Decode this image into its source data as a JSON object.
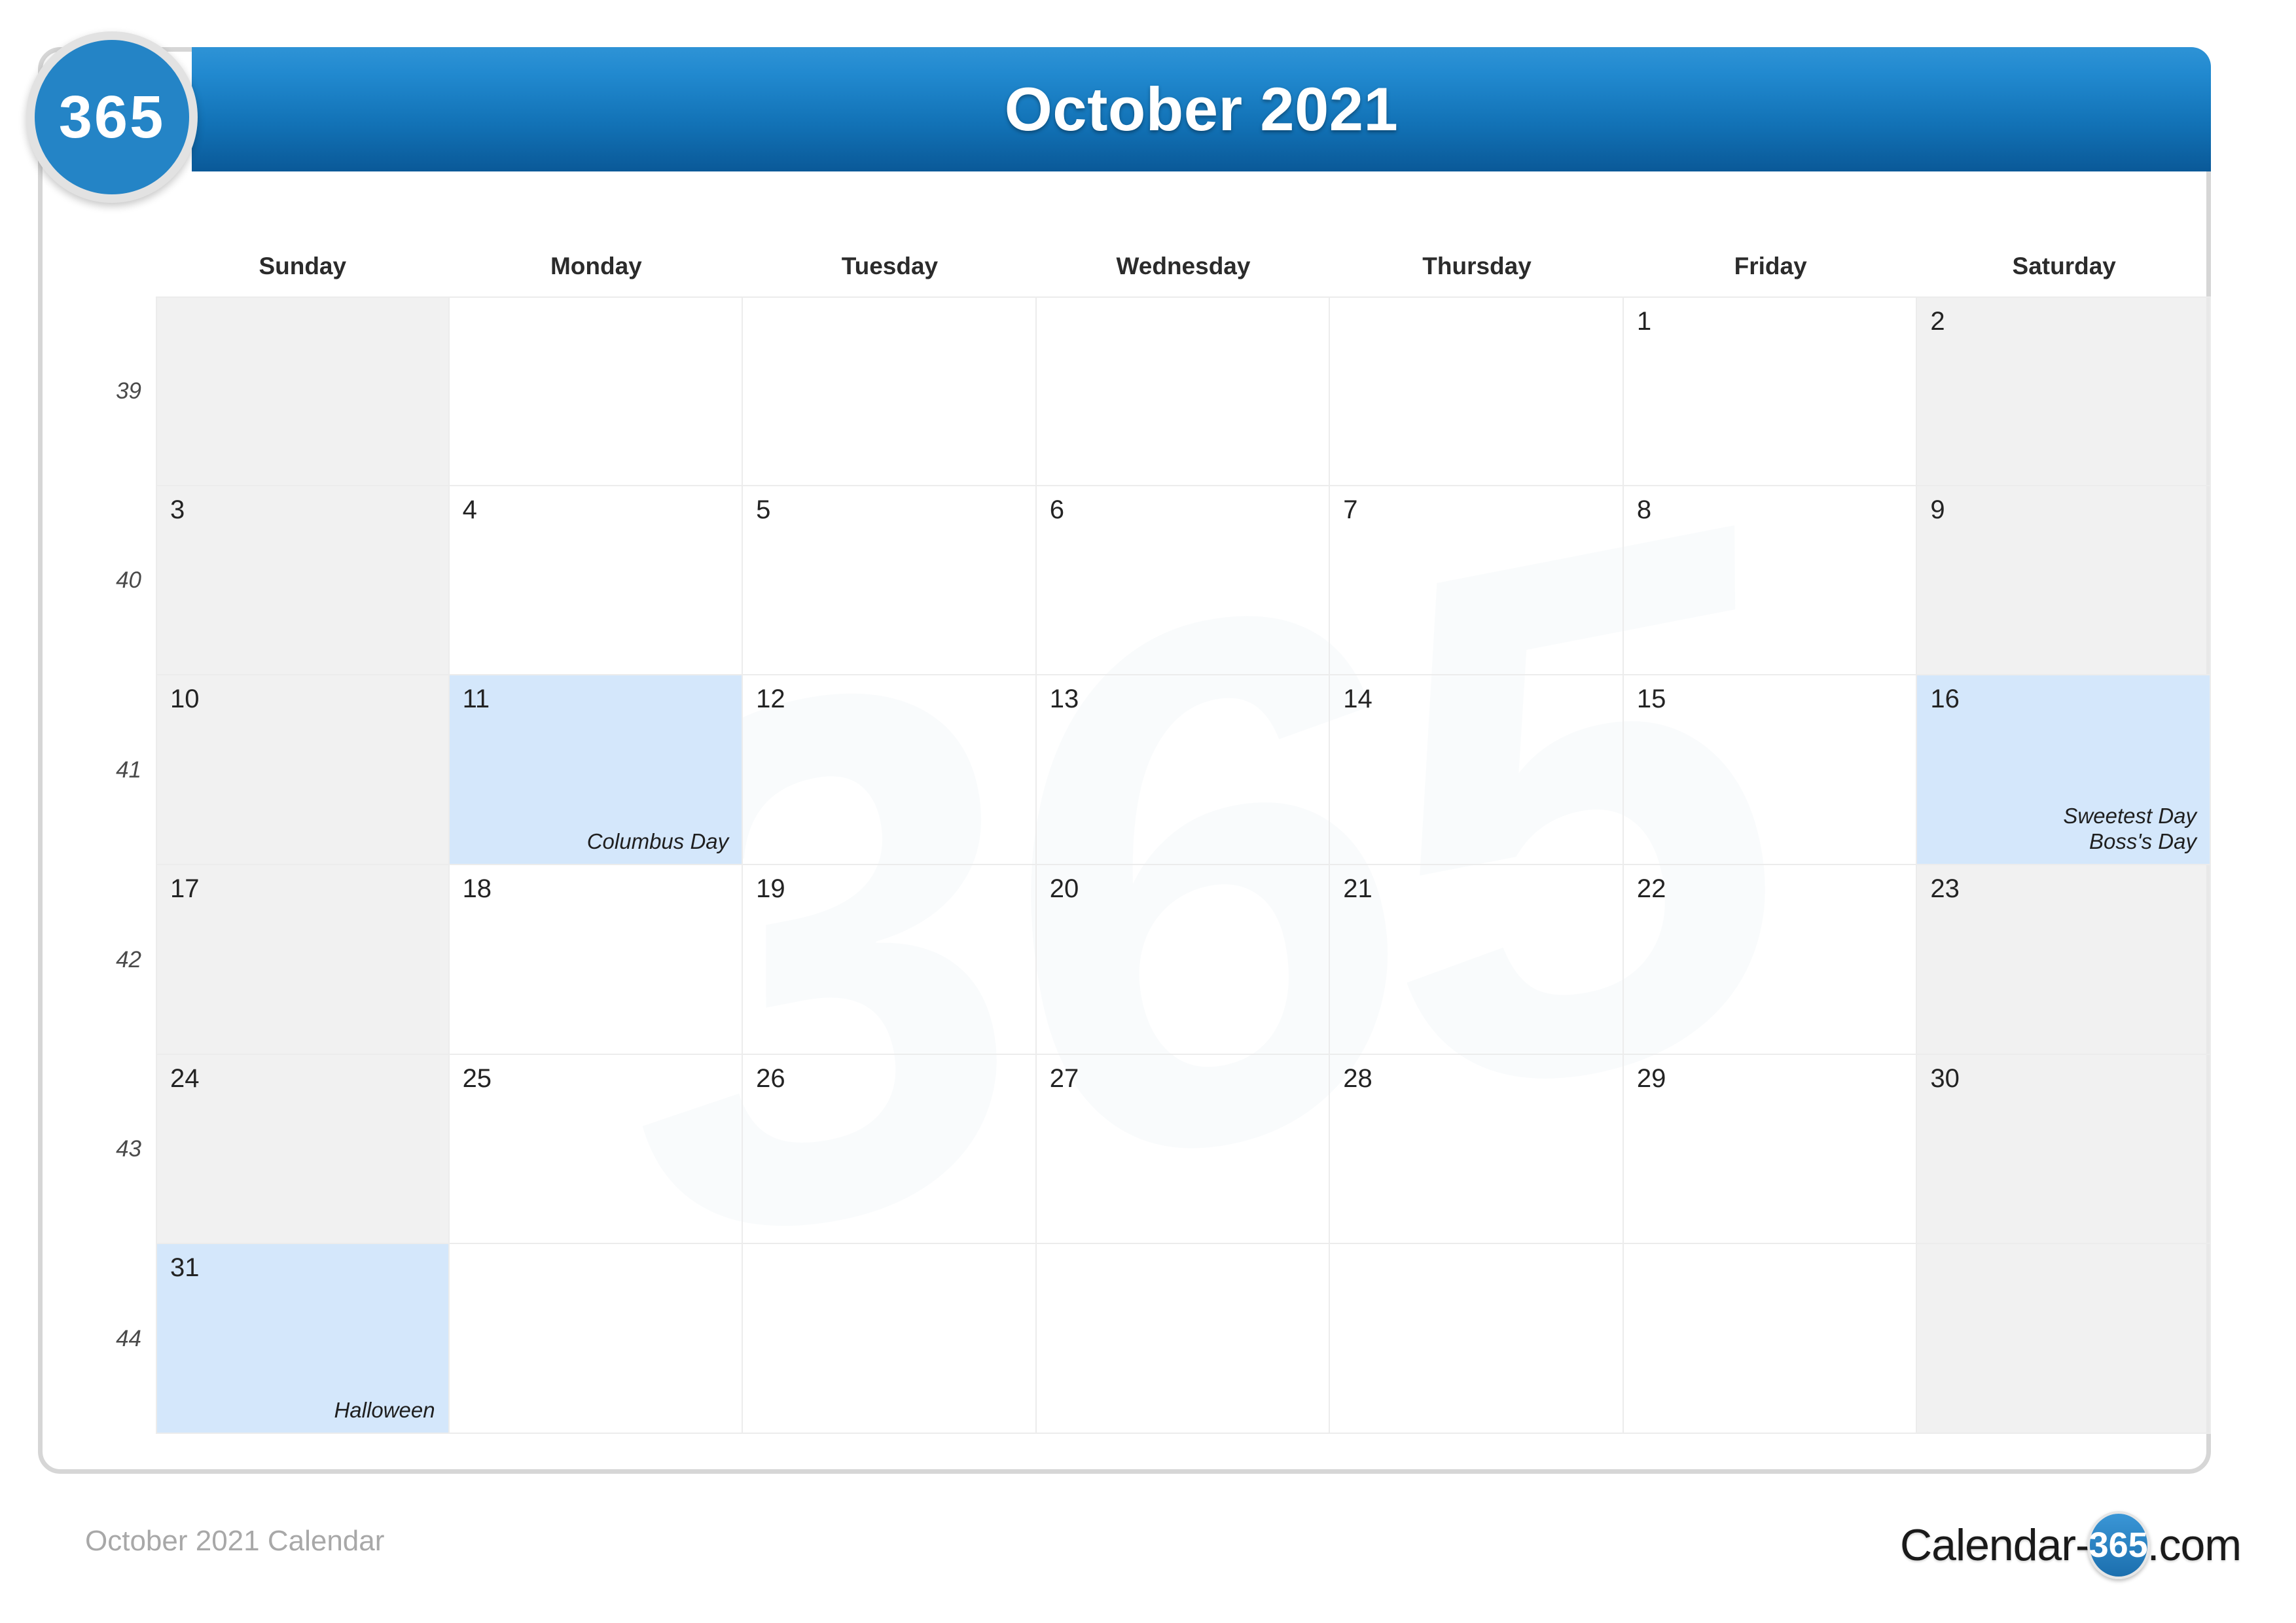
{
  "brand": {
    "badge_text": "365"
  },
  "header": {
    "title": "October 2021"
  },
  "weekdays": [
    "Sunday",
    "Monday",
    "Tuesday",
    "Wednesday",
    "Thursday",
    "Friday",
    "Saturday"
  ],
  "week_numbers": [
    "39",
    "40",
    "41",
    "42",
    "43",
    "44"
  ],
  "colors": {
    "header_blue_top": "#2e93d6",
    "header_blue_bottom": "#0a5998",
    "badge_blue": "#2484c6",
    "weekend_gray": "#ededed",
    "holiday_blue": "#d4e7fb",
    "grid_line": "#ececec",
    "card_border": "#d6d6d6",
    "footer_gray": "#a8a8a8"
  },
  "weeks": [
    {
      "week": "39",
      "days": [
        {
          "num": "",
          "weekend": true,
          "holiday": false,
          "events": []
        },
        {
          "num": "",
          "weekend": false,
          "holiday": false,
          "events": []
        },
        {
          "num": "",
          "weekend": false,
          "holiday": false,
          "events": []
        },
        {
          "num": "",
          "weekend": false,
          "holiday": false,
          "events": []
        },
        {
          "num": "",
          "weekend": false,
          "holiday": false,
          "events": []
        },
        {
          "num": "1",
          "weekend": false,
          "holiday": false,
          "events": []
        },
        {
          "num": "2",
          "weekend": true,
          "holiday": false,
          "events": []
        }
      ]
    },
    {
      "week": "40",
      "days": [
        {
          "num": "3",
          "weekend": true,
          "holiday": false,
          "events": []
        },
        {
          "num": "4",
          "weekend": false,
          "holiday": false,
          "events": []
        },
        {
          "num": "5",
          "weekend": false,
          "holiday": false,
          "events": []
        },
        {
          "num": "6",
          "weekend": false,
          "holiday": false,
          "events": []
        },
        {
          "num": "7",
          "weekend": false,
          "holiday": false,
          "events": []
        },
        {
          "num": "8",
          "weekend": false,
          "holiday": false,
          "events": []
        },
        {
          "num": "9",
          "weekend": true,
          "holiday": false,
          "events": []
        }
      ]
    },
    {
      "week": "41",
      "days": [
        {
          "num": "10",
          "weekend": true,
          "holiday": false,
          "events": []
        },
        {
          "num": "11",
          "weekend": false,
          "holiday": true,
          "events": [
            "Columbus Day"
          ]
        },
        {
          "num": "12",
          "weekend": false,
          "holiday": false,
          "events": []
        },
        {
          "num": "13",
          "weekend": false,
          "holiday": false,
          "events": []
        },
        {
          "num": "14",
          "weekend": false,
          "holiday": false,
          "events": []
        },
        {
          "num": "15",
          "weekend": false,
          "holiday": false,
          "events": []
        },
        {
          "num": "16",
          "weekend": true,
          "holiday": true,
          "events": [
            "Sweetest Day",
            "Boss's Day"
          ]
        }
      ]
    },
    {
      "week": "42",
      "days": [
        {
          "num": "17",
          "weekend": true,
          "holiday": false,
          "events": []
        },
        {
          "num": "18",
          "weekend": false,
          "holiday": false,
          "events": []
        },
        {
          "num": "19",
          "weekend": false,
          "holiday": false,
          "events": []
        },
        {
          "num": "20",
          "weekend": false,
          "holiday": false,
          "events": []
        },
        {
          "num": "21",
          "weekend": false,
          "holiday": false,
          "events": []
        },
        {
          "num": "22",
          "weekend": false,
          "holiday": false,
          "events": []
        },
        {
          "num": "23",
          "weekend": true,
          "holiday": false,
          "events": []
        }
      ]
    },
    {
      "week": "43",
      "days": [
        {
          "num": "24",
          "weekend": true,
          "holiday": false,
          "events": []
        },
        {
          "num": "25",
          "weekend": false,
          "holiday": false,
          "events": []
        },
        {
          "num": "26",
          "weekend": false,
          "holiday": false,
          "events": []
        },
        {
          "num": "27",
          "weekend": false,
          "holiday": false,
          "events": []
        },
        {
          "num": "28",
          "weekend": false,
          "holiday": false,
          "events": []
        },
        {
          "num": "29",
          "weekend": false,
          "holiday": false,
          "events": []
        },
        {
          "num": "30",
          "weekend": true,
          "holiday": false,
          "events": []
        }
      ]
    },
    {
      "week": "44",
      "days": [
        {
          "num": "31",
          "weekend": true,
          "holiday": true,
          "events": [
            "Halloween"
          ]
        },
        {
          "num": "",
          "weekend": false,
          "holiday": false,
          "events": []
        },
        {
          "num": "",
          "weekend": false,
          "holiday": false,
          "events": []
        },
        {
          "num": "",
          "weekend": false,
          "holiday": false,
          "events": []
        },
        {
          "num": "",
          "weekend": false,
          "holiday": false,
          "events": []
        },
        {
          "num": "",
          "weekend": false,
          "holiday": false,
          "events": []
        },
        {
          "num": "",
          "weekend": true,
          "holiday": false,
          "events": []
        }
      ]
    }
  ],
  "watermark": {
    "text": "365"
  },
  "footer": {
    "caption": "October 2021 Calendar",
    "logo_prefix": "Calendar-",
    "logo_badge": "365",
    "logo_suffix": ".com"
  }
}
